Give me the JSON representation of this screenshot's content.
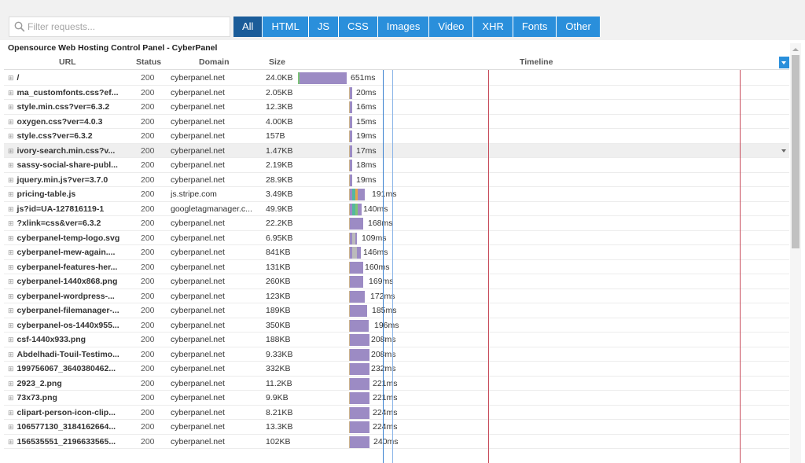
{
  "filter": {
    "placeholder": "Filter requests..."
  },
  "types": [
    "All",
    "HTML",
    "JS",
    "CSS",
    "Images",
    "Video",
    "XHR",
    "Fonts",
    "Other"
  ],
  "active_type": "All",
  "page_title": "Opensource Web Hosting Control Panel - CyberPanel",
  "columns": {
    "url": "URL",
    "status": "Status",
    "domain": "Domain",
    "size": "Size",
    "timeline": "Timeline"
  },
  "colors": {
    "accent": "#2a8fdb",
    "active": "#1b5c99",
    "bar": "#9c8bc4",
    "dom_line": "#3b82d0",
    "load_line": "#c74b5a"
  },
  "requests": [
    {
      "url": "/",
      "status": "200",
      "domain": "cyberpanel.net",
      "size": "24.0KB",
      "time": "651ms"
    },
    {
      "url": "ma_customfonts.css?ef...",
      "status": "200",
      "domain": "cyberpanel.net",
      "size": "2.05KB",
      "time": "20ms"
    },
    {
      "url": "style.min.css?ver=6.3.2",
      "status": "200",
      "domain": "cyberpanel.net",
      "size": "12.3KB",
      "time": "16ms"
    },
    {
      "url": "oxygen.css?ver=4.0.3",
      "status": "200",
      "domain": "cyberpanel.net",
      "size": "4.00KB",
      "time": "15ms"
    },
    {
      "url": "style.css?ver=6.3.2",
      "status": "200",
      "domain": "cyberpanel.net",
      "size": "157B",
      "time": "19ms"
    },
    {
      "url": "ivory-search.min.css?v...",
      "status": "200",
      "domain": "cyberpanel.net",
      "size": "1.47KB",
      "time": "17ms"
    },
    {
      "url": "sassy-social-share-publ...",
      "status": "200",
      "domain": "cyberpanel.net",
      "size": "2.19KB",
      "time": "18ms"
    },
    {
      "url": "jquery.min.js?ver=3.7.0",
      "status": "200",
      "domain": "cyberpanel.net",
      "size": "28.9KB",
      "time": "19ms"
    },
    {
      "url": "pricing-table.js",
      "status": "200",
      "domain": "js.stripe.com",
      "size": "3.49KB",
      "time": "191ms"
    },
    {
      "url": "js?id=UA-127816119-1",
      "status": "200",
      "domain": "googletagmanager.c...",
      "size": "49.9KB",
      "time": "140ms"
    },
    {
      "url": "?xlink=css&ver=6.3.2",
      "status": "200",
      "domain": "cyberpanel.net",
      "size": "22.2KB",
      "time": "168ms"
    },
    {
      "url": "cyberpanel-temp-logo.svg",
      "status": "200",
      "domain": "cyberpanel.net",
      "size": "6.95KB",
      "time": "109ms"
    },
    {
      "url": "cyberpanel-mew-again....",
      "status": "200",
      "domain": "cyberpanel.net",
      "size": "841KB",
      "time": "146ms"
    },
    {
      "url": "cyberpanel-features-her...",
      "status": "200",
      "domain": "cyberpanel.net",
      "size": "131KB",
      "time": "160ms"
    },
    {
      "url": "cyberpanel-1440x868.png",
      "status": "200",
      "domain": "cyberpanel.net",
      "size": "260KB",
      "time": "169ms"
    },
    {
      "url": "cyberpanel-wordpress-...",
      "status": "200",
      "domain": "cyberpanel.net",
      "size": "123KB",
      "time": "172ms"
    },
    {
      "url": "cyberpanel-filemanager-...",
      "status": "200",
      "domain": "cyberpanel.net",
      "size": "189KB",
      "time": "185ms"
    },
    {
      "url": "cyberpanel-os-1440x955...",
      "status": "200",
      "domain": "cyberpanel.net",
      "size": "350KB",
      "time": "196ms"
    },
    {
      "url": "csf-1440x933.png",
      "status": "200",
      "domain": "cyberpanel.net",
      "size": "188KB",
      "time": "208ms"
    },
    {
      "url": "Abdelhadi-Touil-Testimo...",
      "status": "200",
      "domain": "cyberpanel.net",
      "size": "9.33KB",
      "time": "208ms"
    },
    {
      "url": "199756067_3640380462...",
      "status": "200",
      "domain": "cyberpanel.net",
      "size": "332KB",
      "time": "232ms"
    },
    {
      "url": "2923_2.png",
      "status": "200",
      "domain": "cyberpanel.net",
      "size": "11.2KB",
      "time": "221ms"
    },
    {
      "url": "73x73.png",
      "status": "200",
      "domain": "cyberpanel.net",
      "size": "9.9KB",
      "time": "221ms"
    },
    {
      "url": "clipart-person-icon-clip...",
      "status": "200",
      "domain": "cyberpanel.net",
      "size": "8.21KB",
      "time": "224ms"
    },
    {
      "url": "106577130_3184162664...",
      "status": "200",
      "domain": "cyberpanel.net",
      "size": "13.3KB",
      "time": "224ms"
    },
    {
      "url": "156535551_2196633565...",
      "status": "200",
      "domain": "cyberpanel.net",
      "size": "102KB",
      "time": "240ms"
    }
  ]
}
